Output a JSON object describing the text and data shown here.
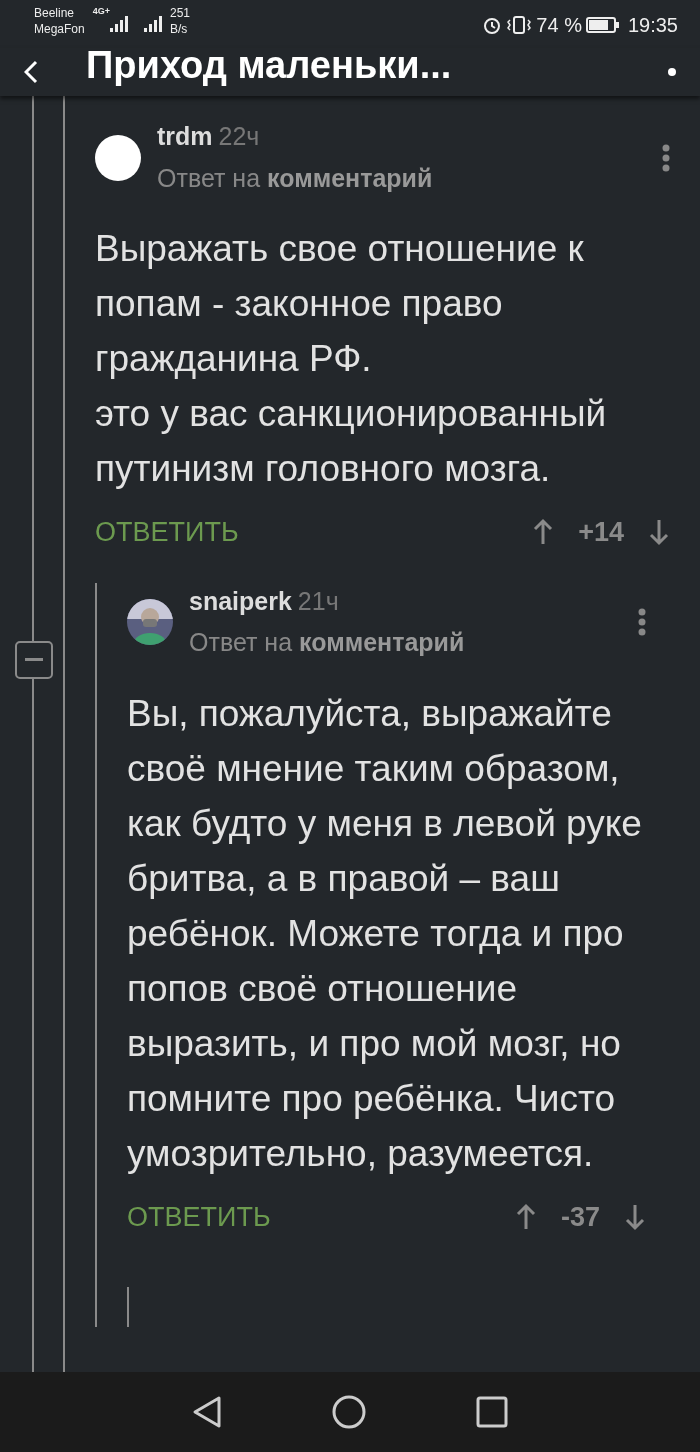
{
  "status_bar": {
    "carriers": [
      "Beeline",
      "MegaFon"
    ],
    "network": "4G+",
    "speed": "251",
    "speed_unit": "B/s",
    "battery": "74 %",
    "time": "19:35"
  },
  "header": {
    "title": "Приход маленьки..."
  },
  "comments": [
    {
      "author": "trdm",
      "time": "22ч",
      "kind": "blank",
      "reply_to": "Ответ на **комментарий**",
      "paragraphs": [
        "Выражать свое отношение к попам - законное право гражданина РФ.",
        "это у вас санкционированный путинизм головного мозга."
      ],
      "reply_label": "ОТВЕТИТЬ",
      "rating": "+14",
      "children": [
        {
          "author": "snaiperk",
          "time": "21ч",
          "kind": "picture",
          "reply_to": "Ответ на **комментарий**",
          "paragraphs": [
            "Вы, пожалуйста, выражайте своё мнение таким образом, как будто у меня в левой руке бритва, а в правой – ваш ребёнок. Можете тогда и про попов своё отношение выразить, и про мой мозг, но помните про ребёнка. Чисто умозрительно, разумеется."
          ],
          "reply_label": "ОТВЕТИТЬ",
          "rating": "-37"
        }
      ]
    }
  ]
}
